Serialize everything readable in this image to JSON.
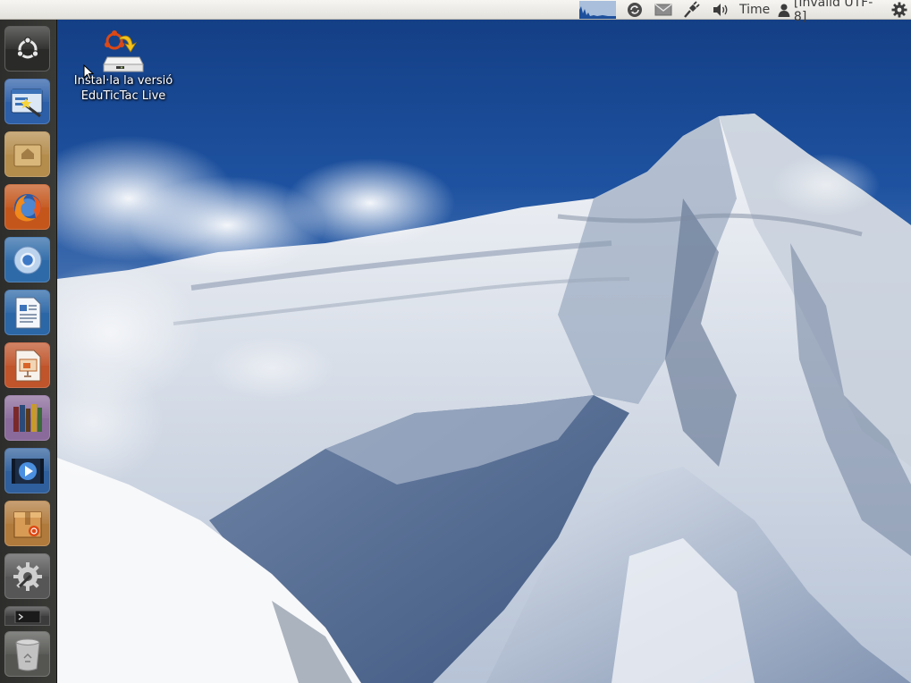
{
  "top_panel": {
    "indicators": [
      {
        "name": "system-monitor",
        "icon": "system-monitor-graph"
      },
      {
        "name": "sync",
        "icon": "sync-icon"
      },
      {
        "name": "messaging",
        "icon": "envelope-icon"
      },
      {
        "name": "network",
        "icon": "network-plug-icon"
      },
      {
        "name": "sound",
        "icon": "speaker-icon"
      }
    ],
    "time_label": "Time",
    "user_label": "[Invalid UTF-8]",
    "session_icon": "gear-icon"
  },
  "launcher": {
    "items": [
      {
        "name": "dash-home",
        "icon": "ubuntu-logo-icon"
      },
      {
        "name": "install-wizard",
        "icon": "wizard-icon"
      },
      {
        "name": "home-folder",
        "icon": "home-folder-icon"
      },
      {
        "name": "firefox",
        "icon": "firefox-icon"
      },
      {
        "name": "chromium",
        "icon": "chromium-icon"
      },
      {
        "name": "libreoffice-writer",
        "icon": "writer-document-icon"
      },
      {
        "name": "libreoffice-impress",
        "icon": "impress-presentation-icon"
      },
      {
        "name": "books",
        "icon": "books-icon"
      },
      {
        "name": "video-player",
        "icon": "video-player-icon"
      },
      {
        "name": "software-center",
        "icon": "software-center-icon"
      },
      {
        "name": "system-settings",
        "icon": "settings-icon"
      },
      {
        "name": "terminal",
        "icon": "terminal-icon"
      },
      {
        "name": "trash",
        "icon": "trash-icon"
      }
    ]
  },
  "desktop": {
    "icon_label_line1": "Instal·la la versió",
    "icon_label_line2": "EduTicTac Live",
    "icon": "installer-drive-icon",
    "wallpaper": "snowy-mountain-peak"
  },
  "colors": {
    "panel_bg": "#efeeea",
    "launcher_bg": "#333331",
    "sky": "#1e52a0"
  }
}
